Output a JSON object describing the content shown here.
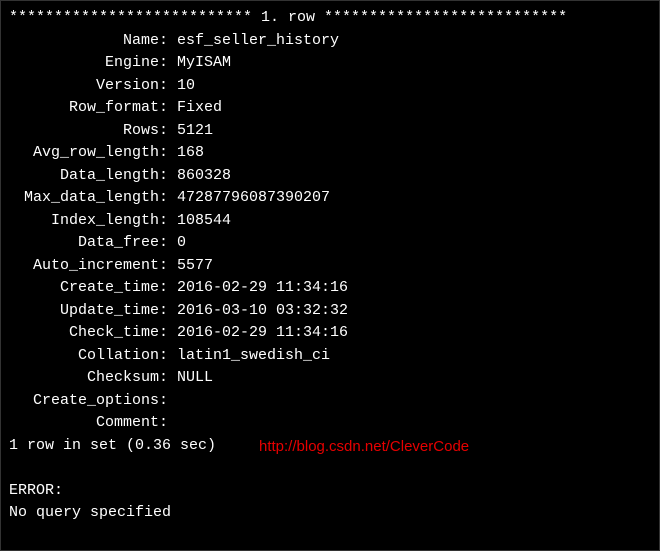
{
  "header": "*************************** 1. row ***************************",
  "fields": [
    {
      "label": "Name",
      "value": "esf_seller_history"
    },
    {
      "label": "Engine",
      "value": "MyISAM"
    },
    {
      "label": "Version",
      "value": "10"
    },
    {
      "label": "Row_format",
      "value": "Fixed"
    },
    {
      "label": "Rows",
      "value": "5121"
    },
    {
      "label": "Avg_row_length",
      "value": "168"
    },
    {
      "label": "Data_length",
      "value": "860328"
    },
    {
      "label": "Max_data_length",
      "value": "47287796087390207"
    },
    {
      "label": "Index_length",
      "value": "108544"
    },
    {
      "label": "Data_free",
      "value": "0"
    },
    {
      "label": "Auto_increment",
      "value": "5577"
    },
    {
      "label": "Create_time",
      "value": "2016-02-29 11:34:16"
    },
    {
      "label": "Update_time",
      "value": "2016-03-10 03:32:32"
    },
    {
      "label": "Check_time",
      "value": "2016-02-29 11:34:16"
    },
    {
      "label": "Collation",
      "value": "latin1_swedish_ci"
    },
    {
      "label": "Checksum",
      "value": "NULL"
    },
    {
      "label": "Create_options",
      "value": ""
    },
    {
      "label": "Comment",
      "value": ""
    }
  ],
  "summary": "1 row in set (0.36 sec)",
  "error_label": "ERROR:",
  "error_msg": "No query specified",
  "watermark": "http://blog.csdn.net/CleverCode"
}
